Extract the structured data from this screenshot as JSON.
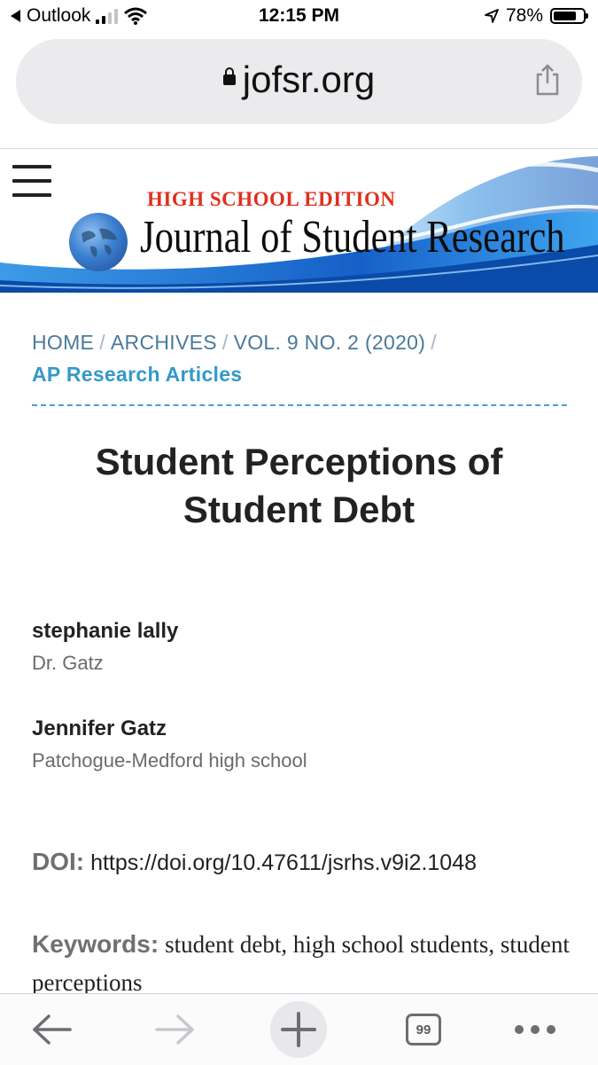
{
  "status_bar": {
    "back_app": "Outlook",
    "time": "12:15 PM",
    "battery": "78%",
    "battery_level": 0.78
  },
  "browser": {
    "url": "jofsr.org",
    "tab_count": "99"
  },
  "banner": {
    "edition": "HIGH SCHOOL EDITION",
    "journal": "Journal of Student Research"
  },
  "breadcrumb": {
    "items": [
      "HOME",
      "ARCHIVES",
      "VOL. 9 NO. 2 (2020)"
    ],
    "current": "AP Research Articles"
  },
  "article": {
    "title": "Student Perceptions of Student Debt",
    "authors": [
      {
        "name": "stephanie lally",
        "affiliation": "Dr. Gatz"
      },
      {
        "name": "Jennifer Gatz",
        "affiliation": "Patchogue-Medford high school"
      }
    ],
    "doi_label": "DOI:",
    "doi": "https://doi.org/10.47611/jsrhs.v9i2.1048",
    "keywords_label": "Keywords:",
    "keywords": "student debt, high school students, student perceptions"
  },
  "colors": {
    "link": "#4a7a9a",
    "current_crumb": "#3399cc",
    "edition_red": "#e0301e",
    "divider_blue": "#46a0d4"
  },
  "icons": [
    "back-arrow-icon",
    "forward-arrow-icon",
    "new-tab-plus-icon",
    "tabs-icon",
    "more-dots-icon",
    "share-icon",
    "lock-icon",
    "wifi-icon",
    "signal-icon",
    "location-icon",
    "battery-icon",
    "globe-logo"
  ]
}
